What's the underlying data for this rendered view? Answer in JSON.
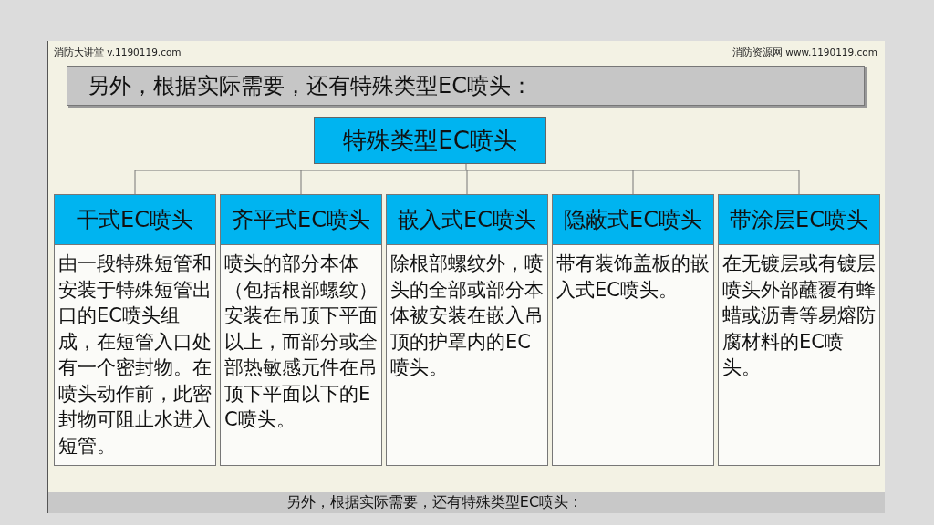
{
  "slide_header": {
    "left": "消防大讲堂 v.1190119.com",
    "right": "消防资源网 www.1190119.com"
  },
  "title": "另外，根据实际需要，还有特殊类型EC喷头：",
  "root": "特殊类型EC喷头",
  "types": [
    {
      "heading": "干式EC喷头",
      "description": "由一段特殊短管和安装于特殊短管出口的EC喷头组成，在短管入口处有一个密封物。在喷头动作前，此密封物可阻止水进入短管。"
    },
    {
      "heading": "齐平式EC喷头",
      "description": "喷头的部分本体（包括根部螺纹）安装在吊顶下平面以上，而部分或全部热敏感元件在吊顶下平面以下的EC喷头。"
    },
    {
      "heading": "嵌入式EC喷头",
      "description": "除根部螺纹外，喷头的全部或部分本体被安装在嵌入吊顶的护罩内的EC喷头。"
    },
    {
      "heading": "隐蔽式EC喷头",
      "description": "带有装饰盖板的嵌入式EC喷头。"
    },
    {
      "heading": "带涂层EC喷头",
      "description": "在无镀层或有镀层喷头外部蘸覆有蜂蜡或沥青等易熔防腐材料的EC喷头。"
    }
  ],
  "caption": "另外，根据实际需要，还有特殊类型EC喷头："
}
